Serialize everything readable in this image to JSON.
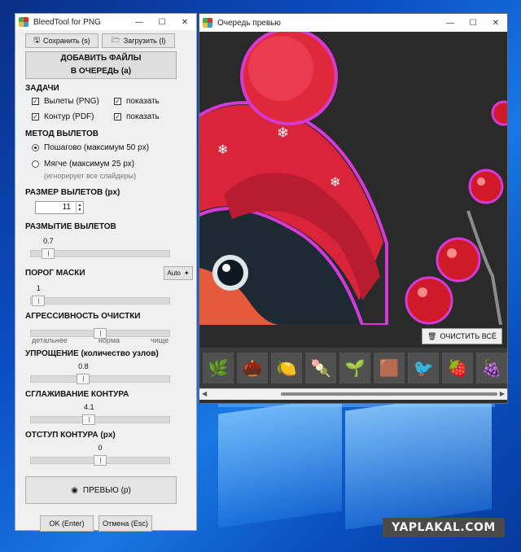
{
  "tool": {
    "title": "BleedTool for PNG",
    "save_label": "Сохранить (s)",
    "load_label": "Загрузить (l)",
    "add_files_line1": "ДОБАВИТЬ ФАЙЛЫ",
    "add_files_line2": "В ОЧЕРЕДЬ (a)",
    "tasks": {
      "title": "ЗАДАЧИ",
      "bleeds_label": "Вылеты (PNG)",
      "outline_label": "Контур (PDF)",
      "show_label": "показать",
      "bleeds_checked": true,
      "outline_checked": true,
      "show_bleeds_checked": true,
      "show_outline_checked": true
    },
    "method": {
      "title": "МЕТОД ВЫЛЕТОВ",
      "step_label": "Пошагово (максимум 50 px)",
      "soft_label": "Мягче (максимум 25 px)",
      "soft_hint": "(игнорирует все слайдеры)",
      "selected": "step"
    },
    "bleed_size": {
      "title": "РАЗМЕР ВЫЛЕТОВ (px)",
      "value": "11"
    },
    "blur": {
      "title": "РАЗМЫТИЕ ВЫЛЕТОВ",
      "value_label": "0.7",
      "fraction": 0.13
    },
    "mask": {
      "title": "ПОРОГ МАСКИ",
      "auto_label": "Auto",
      "value_label": "1",
      "fraction": 0.06
    },
    "aggressiveness": {
      "title": "АГРЕССИВНОСТЬ ОЧИСТКИ",
      "tick_left": "детальнее",
      "tick_mid": "норма",
      "tick_right": "чище",
      "fraction": 0.5
    },
    "simplify": {
      "title": "УПРОЩЕНИЕ (количество узлов)",
      "value_label": "0.8",
      "fraction": 0.38
    },
    "smooth": {
      "title": "СГЛАЖИВАНИЕ КОНТУРА",
      "value_label": "4.1",
      "fraction": 0.42
    },
    "offset": {
      "title": "ОТСТУП КОНТУРА (px)",
      "value_label": "0",
      "fraction": 0.5
    },
    "preview_label": "ПРЕВЬЮ (p)",
    "ok_label": "OK (Enter)",
    "cancel_label": "Отмена (Esc)"
  },
  "preview": {
    "title": "Очередь превью",
    "clear_label": "ОЧИСТИТЬ ВСЁ",
    "thumbnails": [
      "🌿",
      "🌰",
      "🍋",
      "🍡",
      "🌱",
      "🟫",
      "🐦",
      "🍓",
      "🍇"
    ]
  },
  "watermark": "YAPLAKAL.COM",
  "colors": {
    "hat_red": "#d9243a",
    "outline_magenta": "#d43bd6",
    "bird_dark": "#1d2a34"
  }
}
